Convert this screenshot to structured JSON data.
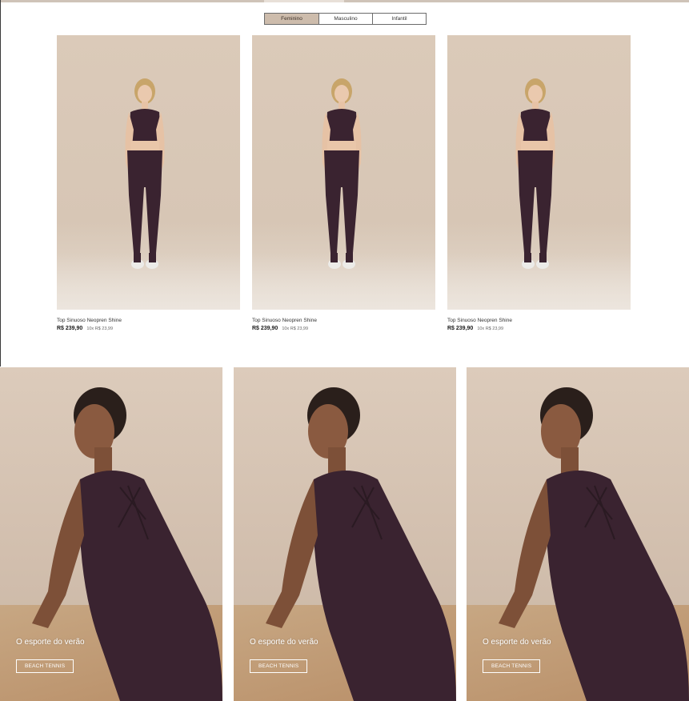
{
  "tabs": [
    {
      "label": "Feminino",
      "active": true
    },
    {
      "label": "Masculino",
      "active": false
    },
    {
      "label": "Infantil",
      "active": false
    }
  ],
  "products": [
    {
      "name": "Top Sinuoso Neopren Shine",
      "price": "R$ 239,90",
      "installments": "10x R$ 23,99"
    },
    {
      "name": "Top Sinuoso Neopren Shine",
      "price": "R$ 239,90",
      "installments": "10x R$ 23,99"
    },
    {
      "name": "Top Sinuoso Neopren Shine",
      "price": "R$ 239,90",
      "installments": "10x R$ 23,99"
    }
  ],
  "banners": [
    {
      "headline": "O esporte do verão",
      "cta": "BEACH TENNIS"
    },
    {
      "headline": "O esporte do verão",
      "cta": "BEACH TENNIS"
    },
    {
      "headline": "O esporte do verão",
      "cta": "BEACH TENNIS"
    }
  ],
  "colors": {
    "active_tab": "#cdbcac",
    "garment": "#3a2330",
    "backdrop": "#d8c7b6"
  }
}
